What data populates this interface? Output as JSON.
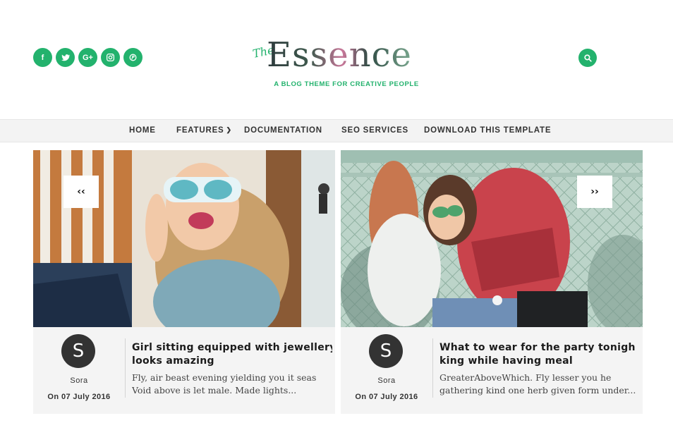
{
  "header": {
    "social": [
      {
        "name": "facebook-icon",
        "glyph": "f"
      },
      {
        "name": "twitter-icon",
        "glyph": ""
      },
      {
        "name": "google-plus-icon",
        "glyph": "G+"
      },
      {
        "name": "instagram-icon",
        "glyph": ""
      },
      {
        "name": "pinterest-icon",
        "glyph": ""
      }
    ],
    "logo_prefix": "The",
    "logo_word": "Essence",
    "tagline": "A BLOG THEME FOR CREATIVE PEOPLE",
    "accent": "#23b26d"
  },
  "nav": {
    "items": [
      {
        "label": "HOME"
      },
      {
        "label": "FEATURES"
      },
      {
        "label": "DOCUMENTATION"
      },
      {
        "label": "SEO SERVICES"
      },
      {
        "label": "DOWNLOAD THIS TEMPLATE"
      }
    ]
  },
  "slider": {
    "prev_label": "‹‹",
    "next_label": "››",
    "posts": [
      {
        "avatar_letter": "S",
        "author": "Sora",
        "date": "On 07 July 2016",
        "title_line1": "Girl sitting equipped with jewellery",
        "title_line2": "looks amazing",
        "excerpt_line1": "Fly, air beast evening yielding you it seas",
        "excerpt_line2": "Void above is let male. Made lights..."
      },
      {
        "avatar_letter": "S",
        "author": "Sora",
        "date": "On 07 July 2016",
        "title_line1": "What to wear for the party tonigh",
        "title_line2": "king while having meal",
        "excerpt_line1": "GreaterAboveWhich. Fly lesser you he",
        "excerpt_line2": "gathering kind one herb given form under..."
      }
    ]
  }
}
